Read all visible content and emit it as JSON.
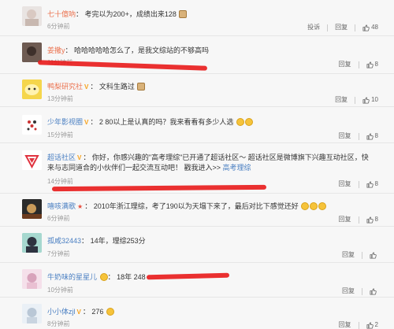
{
  "comments": [
    {
      "username": "七十億吶",
      "badge": "",
      "text": "考完以为200+，成绩出来128",
      "emoji": "dog",
      "time": "6分钟前",
      "extra_action": "投诉",
      "reply": "回复",
      "likes": "48"
    },
    {
      "username": "姜撒y",
      "badge": "",
      "text": "哈哈哈哈哈怎么了，是我文综站的不够高吗",
      "emoji": "",
      "time": "11分钟前",
      "reply": "回复",
      "likes": "8"
    },
    {
      "username": "鸭梨研究社",
      "badge": "V",
      "text": "文科生路过",
      "emoji": "dog",
      "time": "13分钟前",
      "reply": "回复",
      "likes": "10"
    },
    {
      "username": "少年影视圈",
      "badge": "V",
      "text": "2 80以上是认真的吗？我来看看有多少人选",
      "emoji": "double",
      "time": "15分钟前",
      "reply": "回复",
      "likes": "8"
    },
    {
      "username": "超话社区",
      "badge": "V",
      "text": "你好，你感兴趣的\"高考理综\"已开通了超话社区～ 超话社区是微博旗下兴趣互动社区，快来与志同道合的小伙伴们一起交流互动吧！ 戳我进入>>",
      "link": "高考理综",
      "emoji": "",
      "time": "14分钟前",
      "reply": "回复",
      "likes": "8"
    },
    {
      "username": "嘻咳满歌",
      "badge": "★",
      "text": "2010年浙江理综，考了190以为天塌下来了，最后对比下感觉还好",
      "emoji": "triple",
      "time": "6分钟前",
      "reply": "回复",
      "likes": "8"
    },
    {
      "username": "孤咸32443",
      "badge": "",
      "text": "14年，理综253分",
      "emoji": "",
      "time": "7分钟前",
      "reply": "回复",
      "likes": ""
    },
    {
      "username": "牛奶味的星星儿",
      "badge": "",
      "text": "18年 248",
      "emoji": "",
      "time": "10分钟前",
      "reply": "回复",
      "likes": ""
    },
    {
      "username": "小小体zjl",
      "badge": "V",
      "text": "276",
      "emoji": "single",
      "time": "8分钟前",
      "reply": "回复",
      "likes": "2"
    }
  ],
  "colors": {
    "username": "#eb7350",
    "link": "#4a7fc2",
    "highlight_mark": "#e81e1e"
  }
}
